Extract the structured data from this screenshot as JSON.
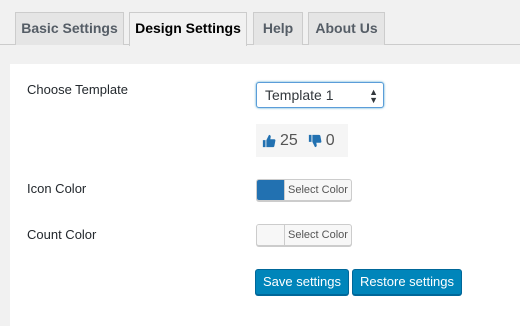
{
  "tabs": [
    {
      "label": "Basic Settings",
      "active": false
    },
    {
      "label": "Design Settings",
      "active": true
    },
    {
      "label": "Help",
      "active": false
    },
    {
      "label": "About Us",
      "active": false
    }
  ],
  "form": {
    "template_label": "Choose Template",
    "template_value": "Template 1",
    "preview": {
      "like_count": "25",
      "dislike_count": "0",
      "like_icon": "thumbs-up-icon",
      "dislike_icon": "thumbs-down-icon"
    },
    "icon_color_label": "Icon Color",
    "icon_color_button": "Select Color",
    "icon_color_value": "#2271b1",
    "count_color_label": "Count Color",
    "count_color_button": "Select Color",
    "count_color_value": "#f7f7f7"
  },
  "actions": {
    "save_label": "Save settings",
    "restore_label": "Restore settings"
  },
  "colors": {
    "primary_button": "#0085ba",
    "thumb_icon": "#2271b1"
  }
}
